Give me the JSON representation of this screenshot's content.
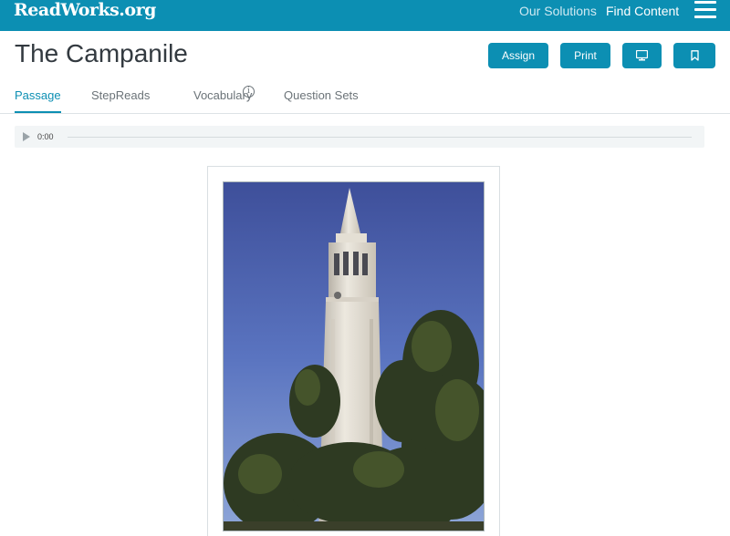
{
  "nav": {
    "logo": "ReadWorks.org",
    "links": [
      "Our Solutions",
      "Find Content"
    ]
  },
  "header": {
    "title": "The Campanile",
    "buttons": {
      "assign": "Assign",
      "print": "Print"
    }
  },
  "tabs": [
    {
      "label": "Passage",
      "active": true
    },
    {
      "label": "StepReads",
      "info": "i"
    },
    {
      "label": "Vocabulary"
    },
    {
      "label": "Question Sets"
    }
  ],
  "audio": {
    "time": "0:00"
  },
  "icons": {
    "menu": "hamburger-icon",
    "present": "monitor-icon",
    "bookmark": "bookmark-icon",
    "play": "play-icon",
    "info": "info-icon"
  },
  "colors": {
    "brand": "#0c8fb3",
    "tab_active": "#0c8fb3",
    "text_dark": "#333a40"
  }
}
